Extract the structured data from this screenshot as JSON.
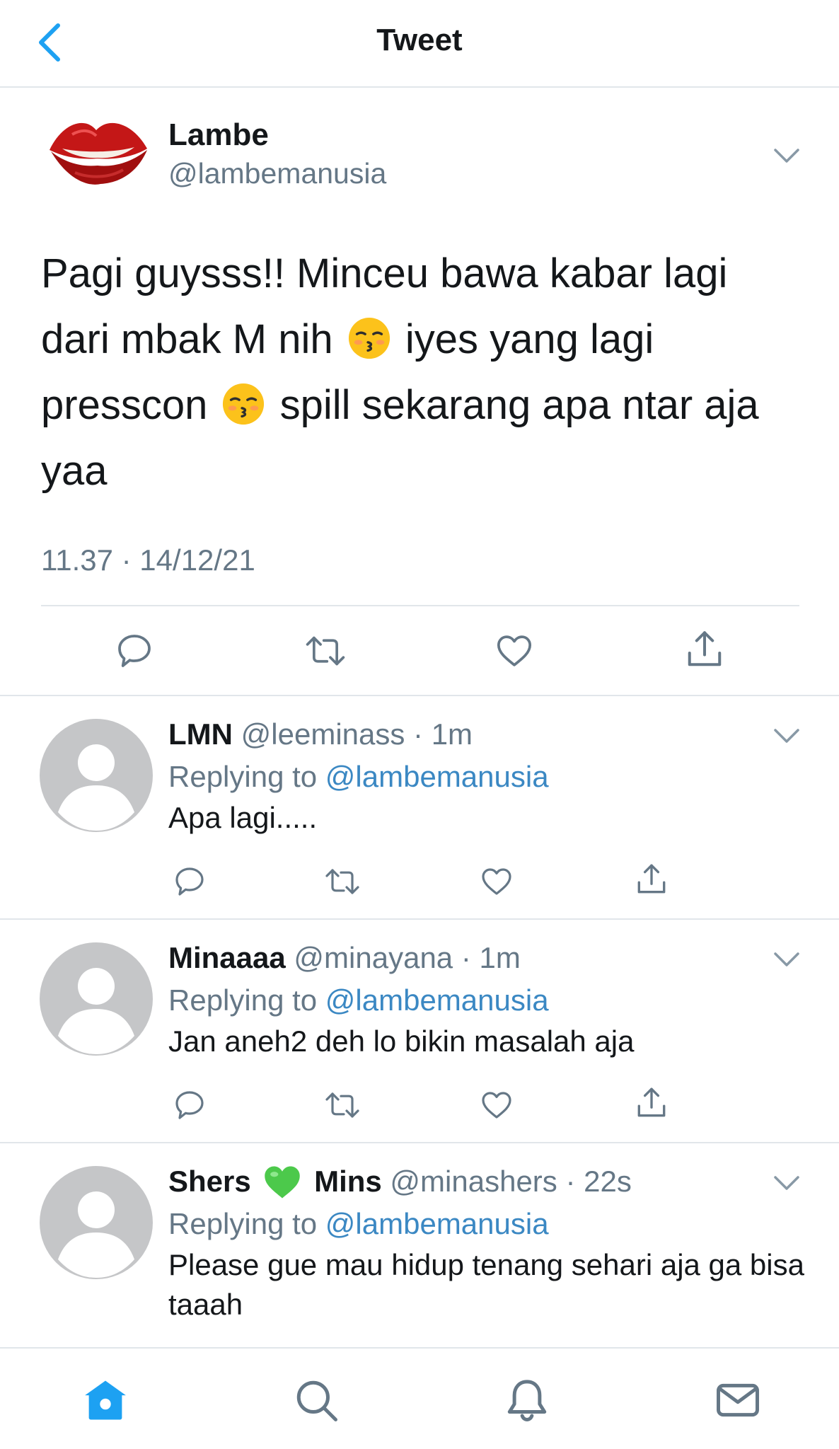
{
  "header": {
    "title": "Tweet",
    "back_icon": "chevron-left-icon"
  },
  "colors": {
    "accent": "#1da1f2",
    "link": "#3b88c3",
    "secondary_text": "#657786",
    "divider": "#e1e6ea",
    "avatar_placeholder": "#c5c6c8"
  },
  "tweet": {
    "name": "Lambe",
    "handle": "@lambemanusia",
    "text_parts": [
      "Pagi guysss!! Minceu bawa kabar lagi dari mbak M nih",
      "iyes yang lagi presscon",
      "spill sekarang apa ntar aja yaa"
    ],
    "emoji": "kissing-face-with-closed-eyes",
    "timestamp": "11.37 · 14/12/21"
  },
  "replies": [
    {
      "name": "LMN",
      "handle_meta": "@leeminass · 1m",
      "replying_prefix": "Replying to",
      "replying_handle": "@lambemanusia",
      "text": "Apa lagi....."
    },
    {
      "name": "Minaaaa",
      "handle_meta": "@minayana · 1m",
      "replying_prefix": "Replying to",
      "replying_handle": "@lambemanusia",
      "text": "Jan aneh2 deh lo bikin masalah aja"
    },
    {
      "name": "Shers",
      "name_emoji": "green-heart",
      "name_suffix": "Mins",
      "handle_meta": "@minashers · 22s",
      "replying_prefix": "Replying to",
      "replying_handle": "@lambemanusia",
      "text": "Please gue mau hidup tenang sehari aja ga bisa taaah"
    }
  ],
  "tabbar": {
    "items": [
      "home-icon",
      "search-icon",
      "notifications-icon",
      "messages-icon"
    ],
    "active": "home-icon"
  }
}
